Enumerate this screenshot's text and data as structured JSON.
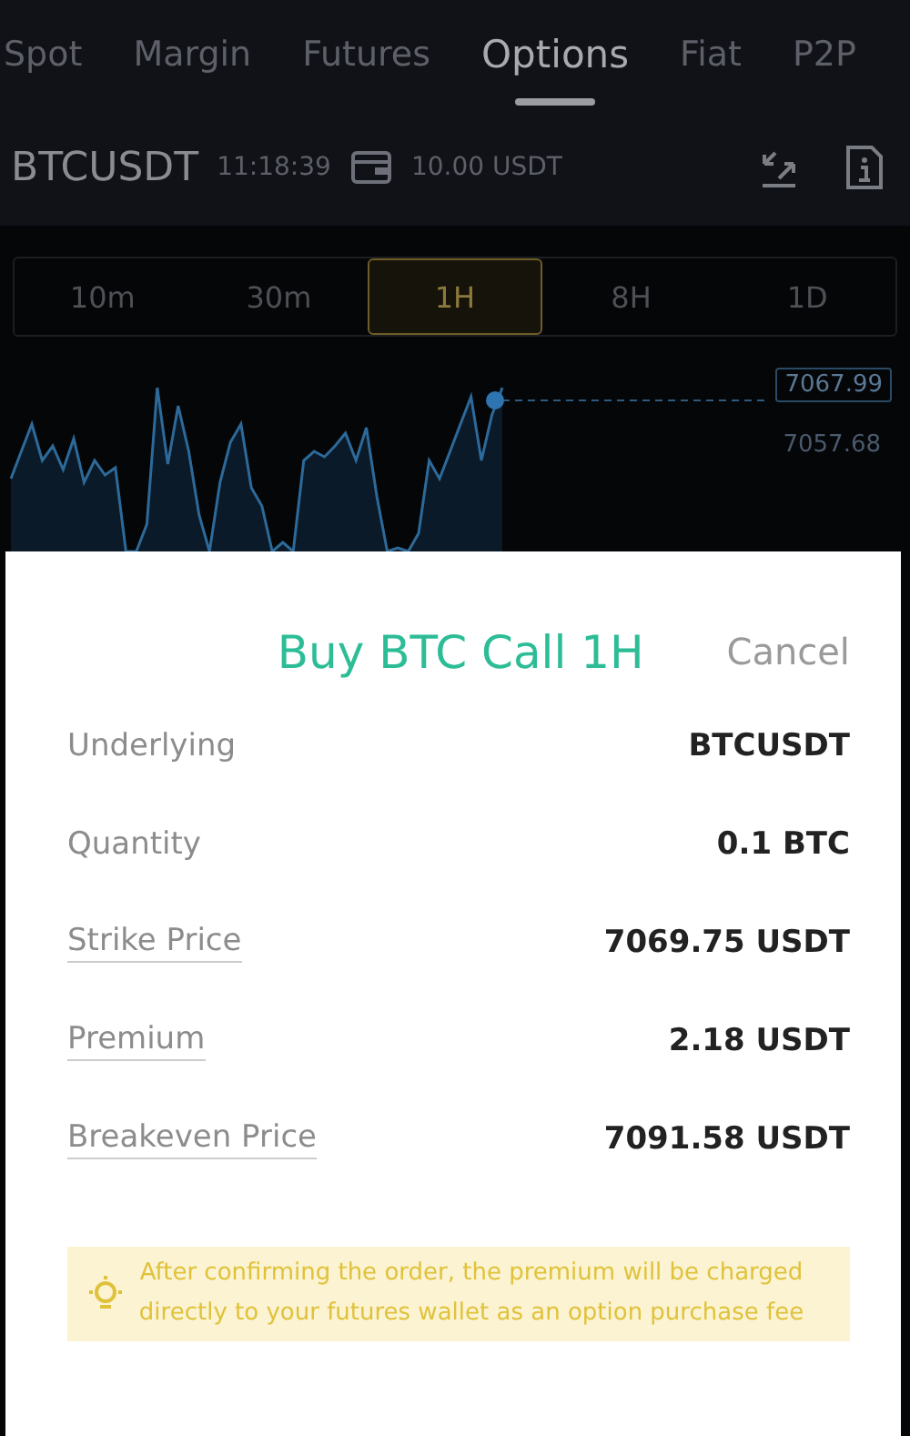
{
  "tabs": [
    {
      "label": "Spot",
      "selected": false
    },
    {
      "label": "Margin",
      "selected": false
    },
    {
      "label": "Futures",
      "selected": false
    },
    {
      "label": "Options",
      "selected": true
    },
    {
      "label": "Fiat",
      "selected": false
    },
    {
      "label": "P2P",
      "selected": false
    }
  ],
  "ticker": {
    "symbol": "BTCUSDT",
    "time": "11:18:39",
    "balance": "10.00 USDT"
  },
  "intervals": [
    {
      "label": "10m",
      "selected": false
    },
    {
      "label": "30m",
      "selected": false
    },
    {
      "label": "1H",
      "selected": true
    },
    {
      "label": "8H",
      "selected": false
    },
    {
      "label": "1D",
      "selected": false
    }
  ],
  "chart": {
    "current_price": "7067.99",
    "axis_labels": [
      "7057.68"
    ]
  },
  "dialog": {
    "title": "Buy BTC Call 1H",
    "cancel": "Cancel",
    "rows": [
      {
        "label": "Underlying",
        "value": "BTCUSDT",
        "underlined": false
      },
      {
        "label": "Quantity",
        "value": "0.1 BTC",
        "underlined": false
      },
      {
        "label": "Strike Price",
        "value": "7069.75 USDT",
        "underlined": true
      },
      {
        "label": "Premium",
        "value": "2.18 USDT",
        "underlined": true
      },
      {
        "label": "Breakeven Price",
        "value": "7091.58 USDT",
        "underlined": true
      }
    ],
    "notice": "After confirming the order, the premium will be charged directly to your futures wallet as an option purchase fee"
  }
}
